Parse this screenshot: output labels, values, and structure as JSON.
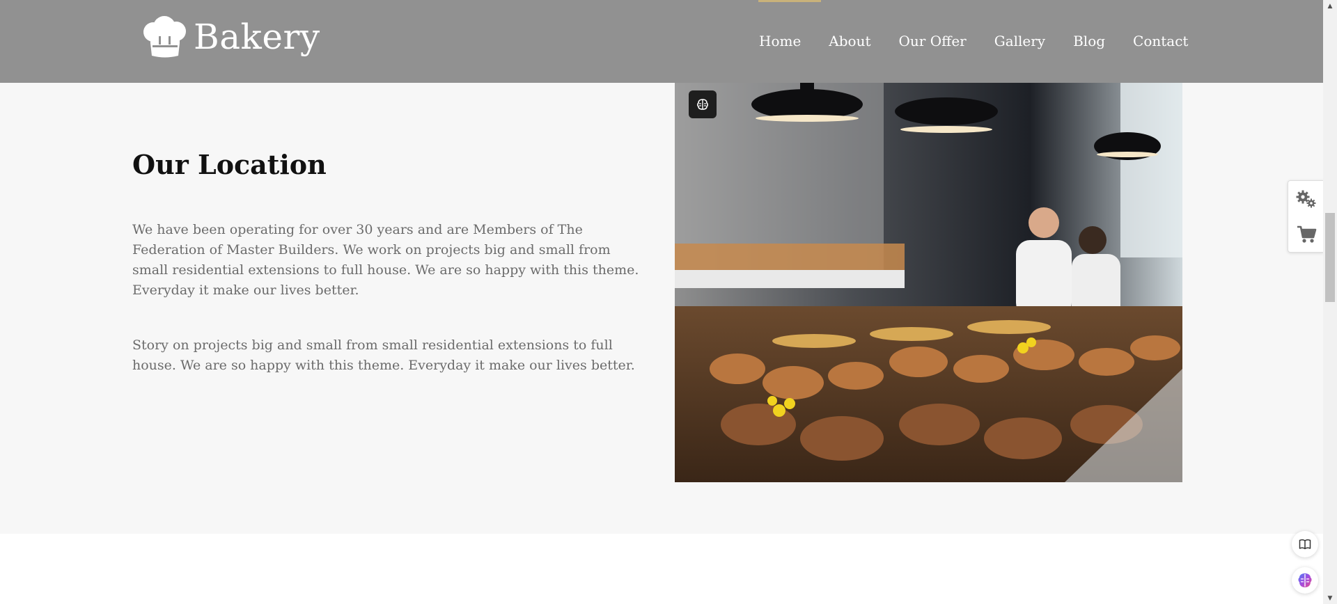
{
  "brand": {
    "name": "Bakery",
    "icon": "chef-hat-icon"
  },
  "nav": {
    "items": [
      {
        "label": "Home"
      },
      {
        "label": "About"
      },
      {
        "label": "Our Offer"
      },
      {
        "label": "Gallery"
      },
      {
        "label": "Blog"
      },
      {
        "label": "Contact"
      }
    ]
  },
  "location": {
    "heading": "Our Location",
    "paragraph1": "We have been operating for over 30 years and are Members of The Federation of Master Builders. We work on projects big and small from small residential extensions to full house. We are so happy with this theme. Everyday it make our lives better.",
    "paragraph2": "Story on projects big and small from small residential extensions to full house. We are so happy with this theme. Everyday it make our lives better.",
    "image_subject": "bakery counter with bread and pastries"
  },
  "side_panel": {
    "icons": [
      "gears-icon",
      "cart-icon"
    ]
  },
  "floating": {
    "icons": [
      "book-icon",
      "brain-icon"
    ]
  },
  "colors": {
    "header": "#919191",
    "accent": "#c9b27a",
    "section_bg": "#f7f7f7"
  }
}
